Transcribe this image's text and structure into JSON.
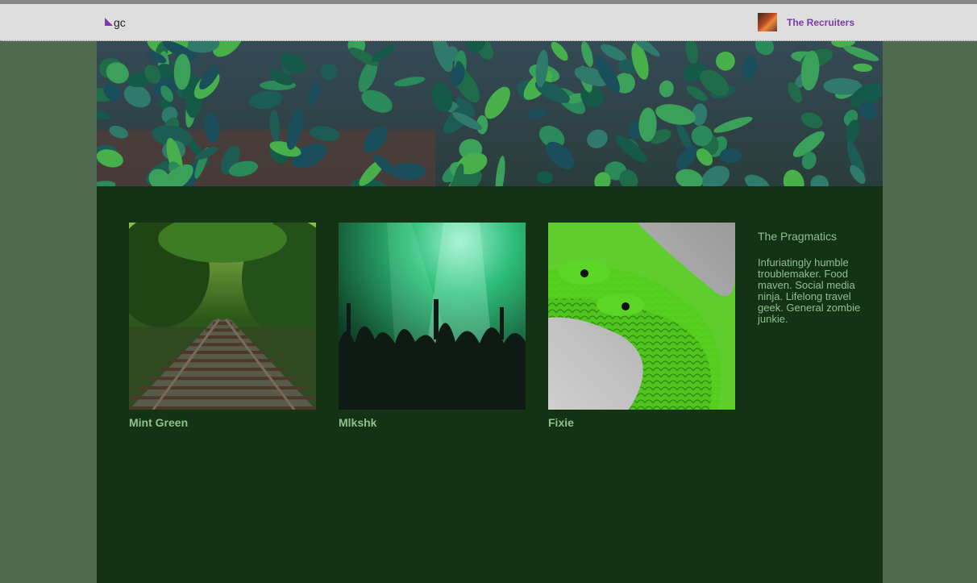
{
  "nav": {
    "logo_text": "gc",
    "user_name": "The Recruiters"
  },
  "cards": [
    {
      "title": "Mint Green",
      "image": "railway-track-forest-photo"
    },
    {
      "title": "Mlkshk",
      "image": "concert-crowd-green-light-photo"
    },
    {
      "title": "Fixie",
      "image": "green-snakes-photo"
    }
  ],
  "sidebar": {
    "title": "The Pragmatics",
    "bio": "Infuriatingly humble troublemaker. Food maven. Social media ninja. Lifelong travel geek. General zombie junkie."
  },
  "colors": {
    "outer_bg": "#4f6a4f",
    "content_bg": "#143214",
    "accent_text": "#8fc08f",
    "link_purple": "#7c3aa6",
    "navbar_bg": "#dedede"
  }
}
